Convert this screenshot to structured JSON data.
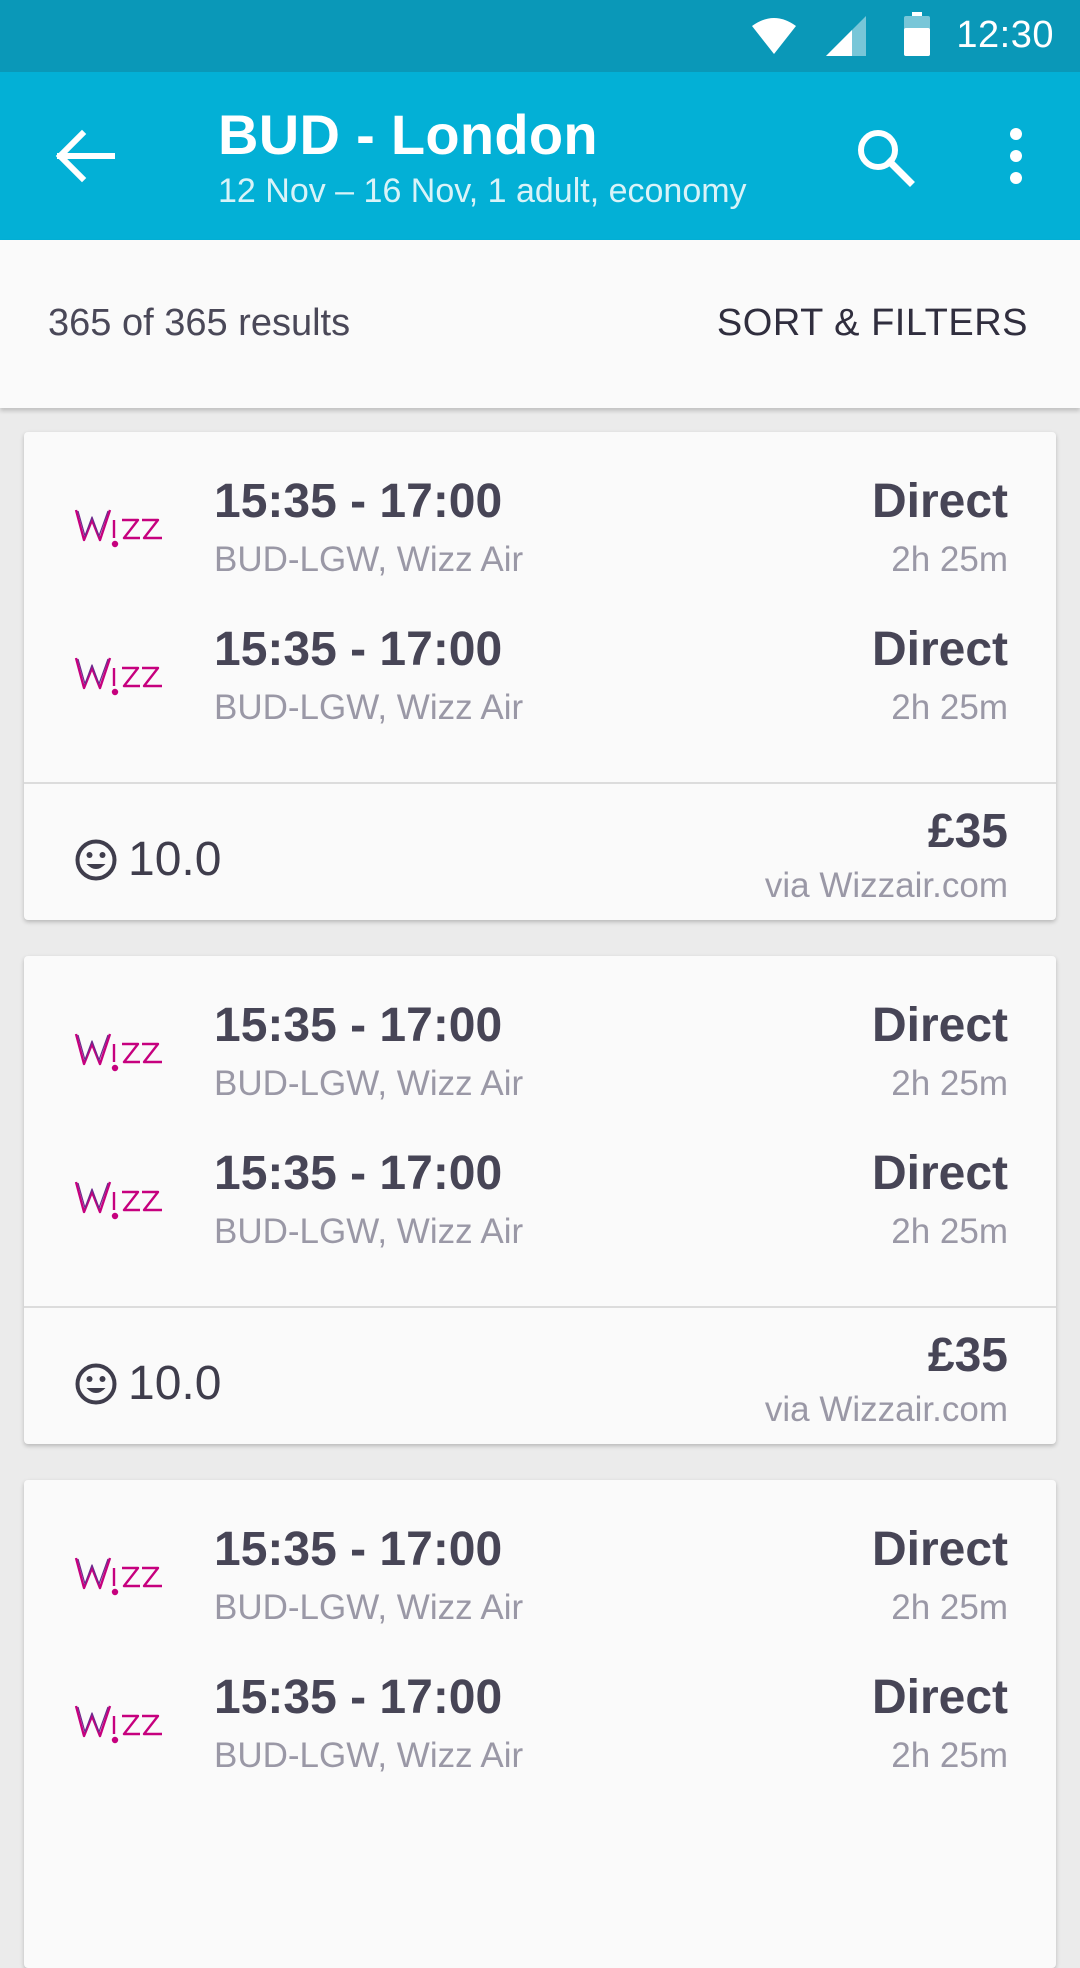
{
  "status": {
    "time": "12:30"
  },
  "appbar": {
    "title": "BUD - London",
    "subtitle": "12 Nov – 16 Nov, 1 adult, economy"
  },
  "results": {
    "count": "365 of 365 results",
    "sort_label": "SORT & FILTERS"
  },
  "colors": {
    "appbar": "#03b0d6",
    "statusbar": "#0a98b8",
    "wizz": "#c6007e"
  },
  "cards": [
    {
      "legs": [
        {
          "times": "15:35 - 17:00",
          "route": "BUD-LGW, Wizz Air",
          "stops": "Direct",
          "duration": "2h 25m"
        },
        {
          "times": "15:35 - 17:00",
          "route": "BUD-LGW, Wizz Air",
          "stops": "Direct",
          "duration": "2h 25m"
        }
      ],
      "rating": "10.0",
      "price": "£35",
      "via": "via Wizzair.com"
    },
    {
      "legs": [
        {
          "times": "15:35 - 17:00",
          "route": "BUD-LGW, Wizz Air",
          "stops": "Direct",
          "duration": "2h 25m"
        },
        {
          "times": "15:35 - 17:00",
          "route": "BUD-LGW, Wizz Air",
          "stops": "Direct",
          "duration": "2h 25m"
        }
      ],
      "rating": "10.0",
      "price": "£35",
      "via": "via Wizzair.com"
    },
    {
      "legs": [
        {
          "times": "15:35 - 17:00",
          "route": "BUD-LGW, Wizz Air",
          "stops": "Direct",
          "duration": "2h 25m"
        },
        {
          "times": "15:35 - 17:00",
          "route": "BUD-LGW, Wizz Air",
          "stops": "Direct",
          "duration": "2h 25m"
        }
      ]
    }
  ]
}
